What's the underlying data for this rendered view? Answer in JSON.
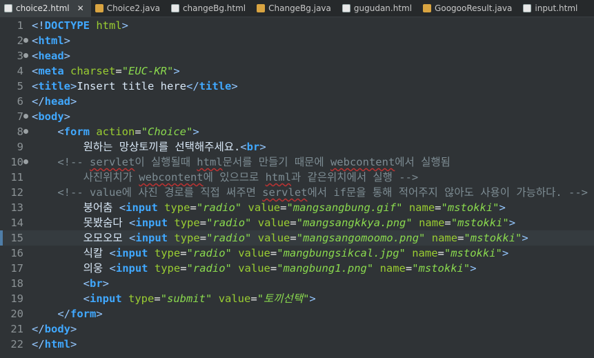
{
  "tabs": [
    {
      "label": "choice2.html",
      "type": "html",
      "active": true,
      "closable": true
    },
    {
      "label": "Choice2.java",
      "type": "java",
      "active": false,
      "closable": false
    },
    {
      "label": "changeBg.html",
      "type": "html",
      "active": false,
      "closable": false
    },
    {
      "label": "ChangeBg.java",
      "type": "java",
      "active": false,
      "closable": false
    },
    {
      "label": "gugudan.html",
      "type": "html",
      "active": false,
      "closable": false
    },
    {
      "label": "GoogooResult.java",
      "type": "java",
      "active": false,
      "closable": false
    },
    {
      "label": "input.html",
      "type": "html",
      "active": false,
      "closable": false
    }
  ],
  "editor": {
    "current_line": 15,
    "lines": [
      {
        "n": "1",
        "t": "<!DOCTYPE html>"
      },
      {
        "n": "2",
        "t": "<html>"
      },
      {
        "n": "3",
        "t": "<head>"
      },
      {
        "n": "4",
        "t": "<meta charset=\"EUC-KR\">"
      },
      {
        "n": "5",
        "t": "<title>Insert title here</title>"
      },
      {
        "n": "6",
        "t": "</head>"
      },
      {
        "n": "7",
        "t": "<body>"
      },
      {
        "n": "8",
        "t": "    <form action=\"Choice\">"
      },
      {
        "n": "9",
        "t": "        원하는 망상토끼를 선택해주세요.<br>"
      },
      {
        "n": "10",
        "t": "    <!-- servlet이 실행될때 html문서를 만들기 때문에 webcontent에서 실행됨"
      },
      {
        "n": "11",
        "t": "        사진위치가 webcontent에 있으므로 html과 같은위치에서 실행 -->"
      },
      {
        "n": "12",
        "t": "    <!-- value에 사진 경로를 직접 써주면 servlet에서 if문을 통해 적어주지 않아도 사용이 가능하다. -->"
      },
      {
        "n": "13",
        "t": "        붕어춤 <input type=\"radio\" value=\"mangsangbung.gif\" name=\"mstokki\">"
      },
      {
        "n": "14",
        "t": "        못봤숨다 <input type=\"radio\" value=\"mangsangkkya.png\" name=\"mstokki\">"
      },
      {
        "n": "15",
        "t": "        오모오모 <input type=\"radio\" value=\"mangsangomoomo.png\" name=\"mstokki\">"
      },
      {
        "n": "16",
        "t": "        식칼 <input type=\"radio\" value=\"mangbungsikcal.jpg\" name=\"mstokki\">"
      },
      {
        "n": "17",
        "t": "        의웅 <input type=\"radio\" value=\"mangbung1.png\" name=\"mstokki\">"
      },
      {
        "n": "18",
        "t": "        <br>"
      },
      {
        "n": "19",
        "t": "        <input type=\"submit\" value=\"토끼선택\">"
      },
      {
        "n": "20",
        "t": "    </form>"
      },
      {
        "n": "21",
        "t": "</body>"
      },
      {
        "n": "22",
        "t": "</html>"
      }
    ]
  },
  "colors": {
    "background": "#2f3336",
    "tag": "#40a8ff",
    "attribute": "#9acd32",
    "string": "#8ad94e",
    "comment": "#7d8c93",
    "text": "#d9e8f7"
  }
}
